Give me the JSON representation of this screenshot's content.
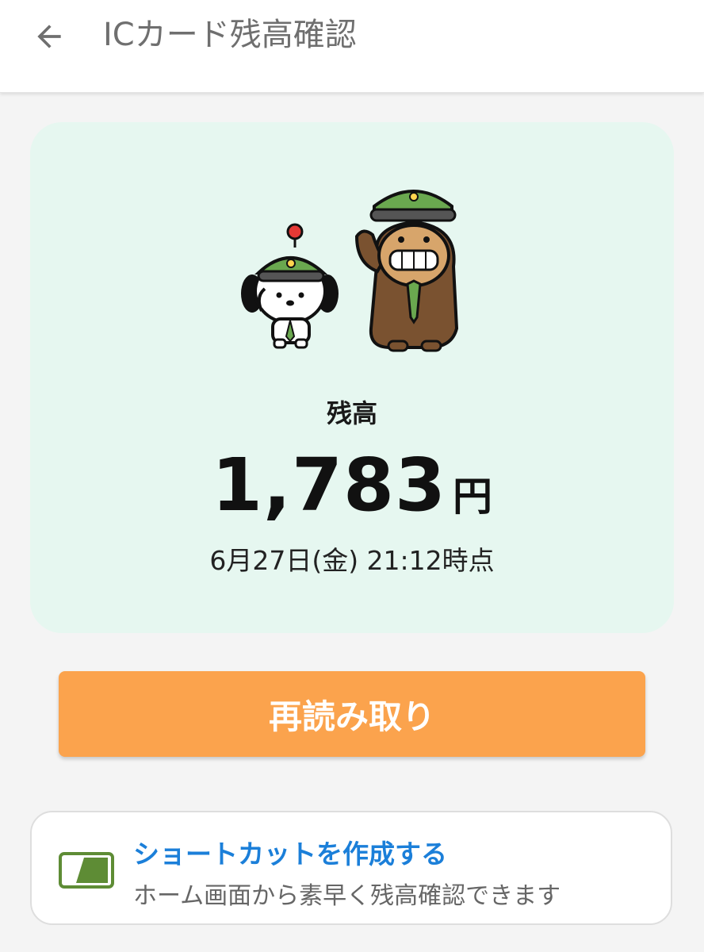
{
  "app_bar": {
    "back_icon": "arrow-back-icon",
    "title": "ICカード残高確認"
  },
  "balance_card": {
    "illustration": "station-staff-mascots",
    "label": "残高",
    "amount": "1,783",
    "unit": "円",
    "as_of": "6月27日(金) 21:12時点",
    "background_color": "#e6f7f0"
  },
  "reread_button": {
    "label": "再読み取り",
    "color": "#fba34d"
  },
  "shortcut": {
    "icon": "card-shortcut-icon",
    "title": "ショートカットを作成する",
    "description": "ホーム画面から素早く残高確認できます",
    "title_color": "#1b7fd9",
    "icon_color": "#5e8c35"
  }
}
